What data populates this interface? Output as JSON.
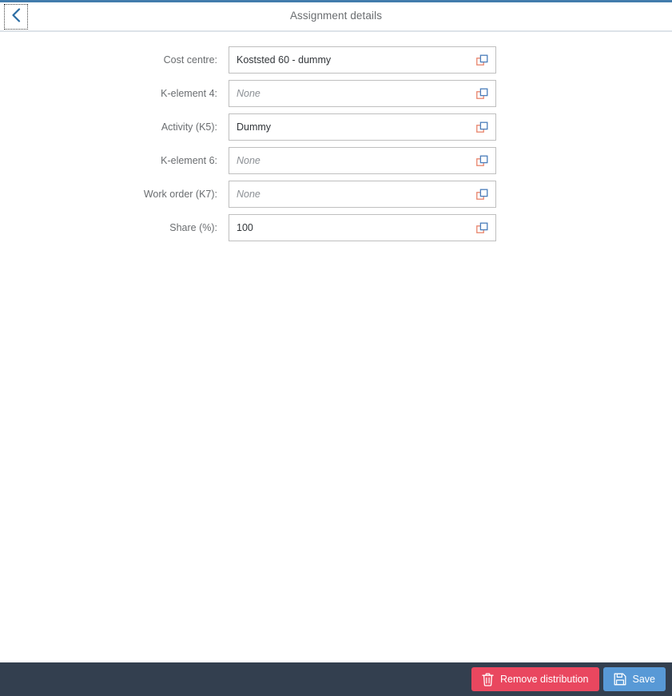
{
  "header": {
    "title": "Assignment details",
    "back_icon": "chevron-left-icon",
    "back_label": "Back"
  },
  "form": {
    "fields": [
      {
        "label": "Cost centre:",
        "value": "Koststed 60 - dummy",
        "is_placeholder": false,
        "value_help_icon": "value-help-icon"
      },
      {
        "label": "K-element 4:",
        "value": "None",
        "is_placeholder": true,
        "value_help_icon": "value-help-icon"
      },
      {
        "label": "Activity (K5):",
        "value": "Dummy",
        "is_placeholder": false,
        "value_help_icon": "value-help-icon"
      },
      {
        "label": "K-element 6:",
        "value": "None",
        "is_placeholder": true,
        "value_help_icon": "value-help-icon"
      },
      {
        "label": "Work order (K7):",
        "value": "None",
        "is_placeholder": true,
        "value_help_icon": "value-help-icon"
      },
      {
        "label": "Share (%):",
        "value": "100",
        "is_placeholder": false,
        "value_help_icon": "value-help-icon"
      }
    ]
  },
  "footer": {
    "remove_label": "Remove distribution",
    "remove_icon": "trash-icon",
    "save_label": "Save",
    "save_icon": "save-floppy-icon"
  },
  "colors": {
    "top_accent": "#427cac",
    "footer_bg": "#333f4f",
    "remove_button": "#e9475f",
    "save_button": "#5899d6",
    "label_text": "#6a6d70",
    "value_text": "#32363a",
    "placeholder_text": "#8b8f94",
    "field_border": "#bfbfbf",
    "icon_blue": "#4a7ebb",
    "icon_orange": "#e8836a"
  }
}
